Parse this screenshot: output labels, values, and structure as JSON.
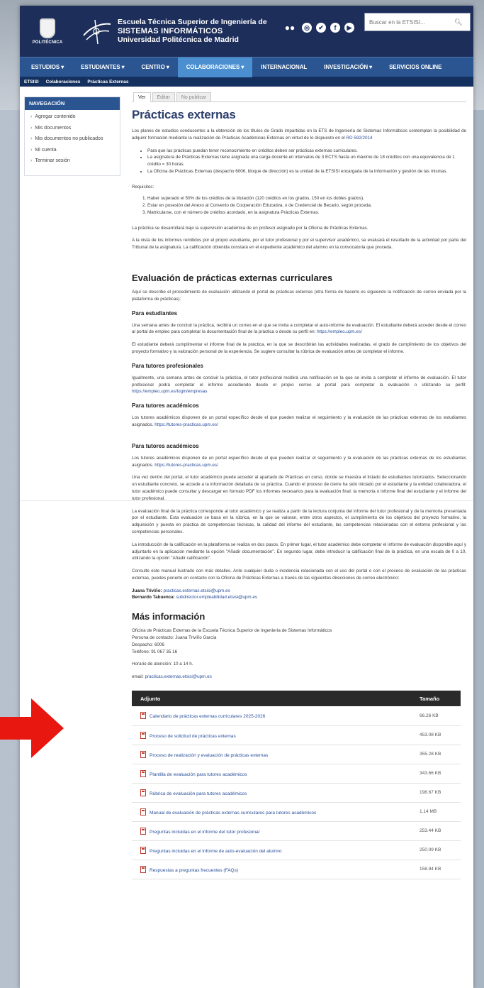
{
  "header": {
    "logo_tag": "POLITÉCNICA",
    "school_line1": "Escuela Técnica Superior de Ingeniería de",
    "school_line2": "SISTEMAS INFORMÁTICOS",
    "school_line3": "Universidad Politécnica de Madrid",
    "search_placeholder": "Buscar en la ETSISI..."
  },
  "nav": {
    "items": [
      "ESTUDIOS ▾",
      "ESTUDIANTES ▾",
      "CENTRO ▾",
      "COLABORACIONES ▾",
      "INTERNACIONAL",
      "INVESTIGACIÓN ▾",
      "SERVICIOS ONLINE"
    ]
  },
  "breadcrumb": [
    "ETSISI",
    "Colaboraciones",
    "Prácticas Externas"
  ],
  "sidebar": {
    "title": "NAVEGACIÓN",
    "items": [
      "Agregar contenido",
      "Mis documentos",
      "Mis documentos no publicados",
      "Mi cuenta",
      "Terminar sesión"
    ]
  },
  "tabs": [
    "Ver",
    "Editar",
    "No publicar"
  ],
  "page": {
    "title": "Prácticas externas",
    "intro": "Los planes de estudios conducentes a la obtención de los títulos de Grado impartidas en la ETS de Ingeniería de Sistemas Informáticos contemplan la posibilidad de adquirir formación mediante la realización de Prácticas Académicas Externas en virtud de lo dispuesto en el ",
    "intro_link": "RD 592/2014",
    "bullets": [
      "Para que las prácticas puedan tener reconocimiento en créditos deben ser prácticas externas curriculares.",
      "La asignatura de Prácticas Externas tiene asignada una carga docente en intervalos de 3 ECTS hasta un máximo de 18 créditos con una equivalencia de 1 crédito = 30 horas.",
      "La Oficina de Prácticas Externas (despacho 6006, bloque de dirección) es la unidad de la ETSISI encargada de la información y gestión de las mismas."
    ],
    "req_label": "Requisitos:",
    "requisitos": [
      "Haber superado el 50% de los créditos de la titulación (120 créditos en los grados, 150 en los dobles grados).",
      "Estar en posesión del Anexo al Convenio de Cooperación Educativa, o de Credencial de Becario, según proceda.",
      "Matricularse, con el número de créditos acordado, en la asignatura Prácticas Externas."
    ],
    "p1": "La práctica se desarrollará bajo la supervisión académica de un profesor asignado por la Oficina de Prácticas Externas.",
    "p2": "A la vista de los informes remitidos por el propio estudiante, por el tutor profesional y por el supervisor académico, se evaluará el resultado de la actividad por parte del Tribunal de la asignatura. La calificación obtenida constará en el expediente académico del alumno en la convocatoria que proceda.",
    "eval_title": "Evaluación de prácticas externas curriculares",
    "eval_intro": "Aquí se describe el procedimiento de evaluación utilizando el portal de prácticas externas (otra forma de hacerlo es siguiendo la notificación de correo enviada por la plataforma de prácticas):",
    "est_title": "Para estudiantes",
    "est_p1": "Una semana antes de concluir la práctica, recibirá un correo en el que se invita a completar el auto-informe de evaluación. El estudiante deberá acceder desde el correo al portal de empleo para completar la documentación final de la práctica o desde su perfil en: ",
    "est_link": "https://empleo.upm.es/",
    "est_p2": "El estudiante deberá cumplimentar el informe final de la práctica, en la que se describirán las actividades realizadas, el grado de cumplimiento de los objetivos del proyecto formativo y la valoración personal de la experiencia. Se sugiere consultar la rúbrica de evaluación antes de completar el informe.",
    "prof_title": "Para tutores profesionales",
    "prof_p": "Igualmente, una semana antes de concluir la práctica, el tutor profesional recibirá una notificación en la que se invita a completar el informe de evaluación. El tutor profesional podrá completar el informe accediendo desde el propio correo al portal para completar la evaluación o utilizando su perfil: ",
    "prof_link": "https://empleo.upm.es/login/empresas",
    "acad_title": "Para tutores académicos",
    "acad_p": "Los tutores académicos disponen de un portal específico desde el que pueden realizar el seguimiento y la evaluación de las prácticas externas de los estudiantes asignados. ",
    "acad_link": "https://tutores-practicas.upm.es/",
    "acad_p2": "Una vez dentro del portal, el tutor académico puede acceder al apartado de Prácticas en curso, donde se muestra el listado de estudiantes tutorizados. Seleccionando un estudiante concreto, se accede a la información detallada de su práctica. Cuando el proceso de cierre ha sido iniciado por el estudiante y la entidad colaboradora, el tutor académico puede consultar y descargar en formato PDF los informes necesarios para la evaluación final: la memoria o informe final del estudiante y el informe del tutor profesional.",
    "acad_p3": "La evaluación final de la práctica corresponde al tutor académico y se realiza a partir de la lectura conjunta del informe del tutor profesional y de la memoria presentada por el estudiante. Esta evaluación se basa en la rúbrica, en la que se valoran, entre otros aspectos, el cumplimiento de los objetivos del proyecto formativo, la adquisición y puesta en práctica de competencias técnicas, la calidad del informe del estudiante, las competencias relacionadas con el entorno profesional y las competencias personales.",
    "acad_p4": "La introducción de la calificación en la plataforma se realiza en dos pasos. En primer lugar, el tutor académico debe completar el informe de evaluación disponible aquí y adjuntarlo en la aplicación mediante la opción \"Añadir documentación\". En segundo lugar, debe introducir la calificación final de la práctica, en una escala de 0 a 10, utilizando la opción \"Añadir calificación\".",
    "acad_p5": "Consulte este manual ilustrado con más detalles. Ante cualquier duda o incidencia relacionada con el uso del portal o con el proceso de evaluación de las prácticas externas, puedes ponerte en contacto con la Oficina de Prácticas Externas a través de las siguientes direcciones de correo electrónico:",
    "contact1_name": "Juana Triviño:",
    "contact1_mail": "practicas.externas.etsisi@upm.es",
    "contact2_name": "Bernardo Tabuenca:",
    "contact2_mail": "subdirector.empleabilidad.etsisi@upm.es",
    "more_title": "Más información",
    "more_lines": [
      "Oficina de Prácticas Externas de la Escuela Técnica Superior de Ingeniería de Sistemas Informáticos",
      "Persona de contacto: Juana Triviño García",
      "Despacho: 6006",
      "Teléfono: 91 067 35 16"
    ],
    "horario": "Horario de atención: 10 a 14 h.",
    "email_label": "email: ",
    "email": "practicas.externas.etsisi@upm.es"
  },
  "attachments": {
    "col_name": "Adjunto",
    "col_size": "Tamaño",
    "rows": [
      {
        "name": "Calendario de prácticas externas curriculares 2025-2026",
        "size": "66.26 KB"
      },
      {
        "name": "Proceso de solicitud de prácticas externas",
        "size": "453.08 KB"
      },
      {
        "name": "Proceso de realización y evaluación de prácticas externas",
        "size": "355.28 KB"
      },
      {
        "name": "Plantilla de evaluación para tutores académicos",
        "size": "343.66 KB"
      },
      {
        "name": "Rúbrica de evaluación para tutores académicos",
        "size": "198.67 KB"
      },
      {
        "name": "Manual de evaluación de prácticas externas curriculares para tutores académicos",
        "size": "1.14 MB"
      },
      {
        "name": "Preguntas incluidas en el informe del tutor profesional",
        "size": "253.44 KB"
      },
      {
        "name": "Preguntas incluidas en el informe de auto-evaluación del alumno",
        "size": "250.09 KB"
      },
      {
        "name": "Respuestas a preguntas frecuentes (FAQs)",
        "size": "158.94 KB"
      }
    ]
  },
  "colors": {
    "header_bg": "#1d2e5a",
    "nav_bg": "#2a5591",
    "nav_active": "#4b8fd0",
    "arrow": "#e8170f"
  }
}
